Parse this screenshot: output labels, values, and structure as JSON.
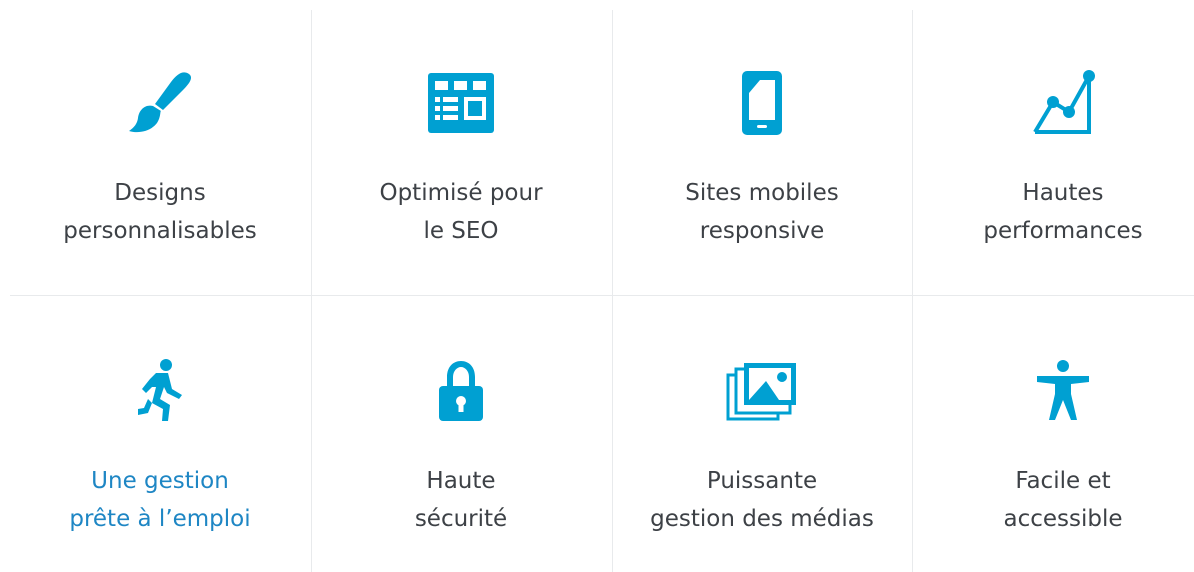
{
  "accent_color": "#00a0d2",
  "text_color": "#3d4146",
  "link_color": "#1e86c4",
  "features": [
    {
      "icon": "paintbrush-icon",
      "line1": "Designs",
      "line2": "personnalisables"
    },
    {
      "icon": "layout-grid-icon",
      "line1": "Optimisé pour",
      "line2": "le SEO"
    },
    {
      "icon": "mobile-phone-icon",
      "line1": "Sites mobiles",
      "line2": "responsive"
    },
    {
      "icon": "line-chart-icon",
      "line1": "Hautes",
      "line2": "performances"
    },
    {
      "icon": "running-person-icon",
      "line1": "Une gestion",
      "line2": "prête à l’emploi"
    },
    {
      "icon": "padlock-icon",
      "line1": "Haute",
      "line2": "sécurité"
    },
    {
      "icon": "photo-stack-icon",
      "line1": "Puissante",
      "line2": "gestion des médias"
    },
    {
      "icon": "accessibility-person-icon",
      "line1": "Facile et",
      "line2": "accessible"
    }
  ]
}
